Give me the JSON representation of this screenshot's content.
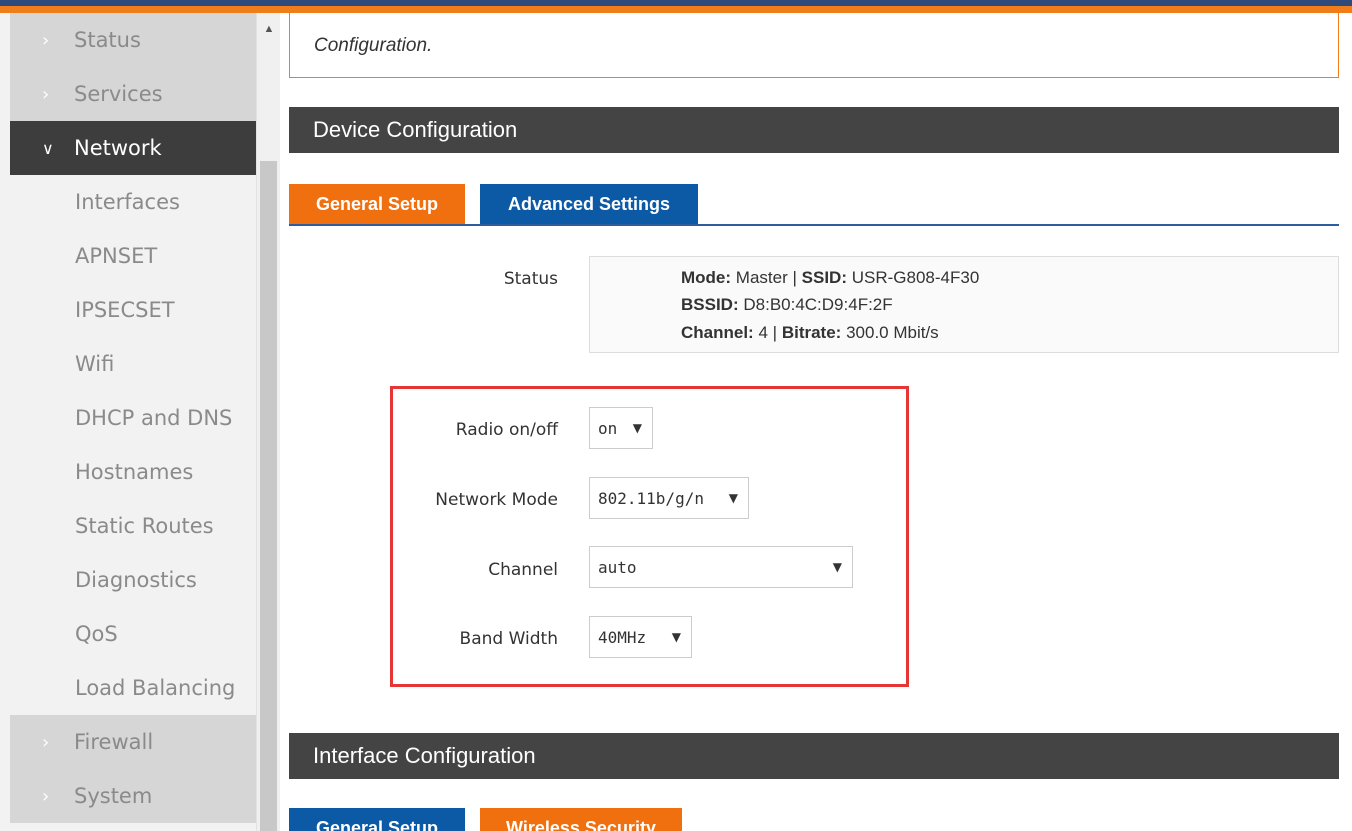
{
  "sidebar": {
    "top_items": [
      {
        "label": "Status"
      },
      {
        "label": "Services"
      }
    ],
    "active_item": {
      "label": "Network"
    },
    "sub_items": [
      {
        "label": "Interfaces"
      },
      {
        "label": "APNSET"
      },
      {
        "label": "IPSECSET"
      },
      {
        "label": "Wifi"
      },
      {
        "label": "DHCP and DNS"
      },
      {
        "label": "Hostnames"
      },
      {
        "label": "Static Routes"
      },
      {
        "label": "Diagnostics"
      },
      {
        "label": "QoS"
      },
      {
        "label": "Load Balancing"
      }
    ],
    "bottom_items": [
      {
        "label": "Firewall"
      },
      {
        "label": "System"
      }
    ]
  },
  "notice": {
    "text": "Configuration."
  },
  "device_section": {
    "title": "Device Configuration",
    "tabs": [
      {
        "label": "General Setup"
      },
      {
        "label": "Advanced Settings"
      }
    ]
  },
  "status": {
    "label": "Status",
    "mode_key": "Mode:",
    "mode_value": "Master",
    "sep": "|",
    "ssid_key": "SSID:",
    "ssid_value": "USR-G808-4F30",
    "bssid_key": "BSSID:",
    "bssid_value": "D8:B0:4C:D9:4F:2F",
    "channel_key": "Channel:",
    "channel_value": "4",
    "bitrate_key": "Bitrate:",
    "bitrate_value": "300.0 Mbit/s"
  },
  "fields": {
    "radio": {
      "label": "Radio on/off",
      "value": "on"
    },
    "network_mode": {
      "label": "Network Mode",
      "value": "802.11b/g/n"
    },
    "channel": {
      "label": "Channel",
      "value": "auto"
    },
    "band_width": {
      "label": "Band Width",
      "value": "40MHz"
    }
  },
  "interface_section": {
    "title": "Interface Configuration",
    "tabs": [
      {
        "label": "General Setup"
      },
      {
        "label": "Wireless Security"
      }
    ]
  },
  "colors": {
    "accent_orange": "#f07d1a",
    "accent_blue": "#0c5aa6",
    "highlight_red": "#e53535",
    "section_dark": "#444444"
  }
}
